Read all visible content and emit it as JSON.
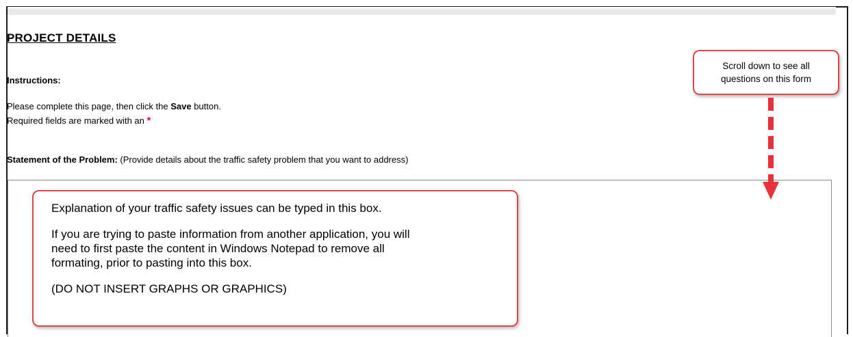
{
  "form": {
    "section_title": "PROJECT DETAILS",
    "instructions_label": "Instructions:",
    "line1_pre": "Please complete this page, then click the ",
    "line1_bold": "Save",
    "line1_post": " button.",
    "line2": "Required fields are marked with an ",
    "required_marker": "*",
    "statement_label": "Statement of the Problem:",
    "statement_hint": " (Provide details about the traffic safety problem that you want to address)"
  },
  "callouts": {
    "scroll_note": {
      "line1": "Scroll down to see all",
      "line2": "questions on this form"
    },
    "textbox_note": {
      "p1": "Explanation of your traffic safety issues can be typed in this box.",
      "p2_line1": "If you are trying to paste information from another application, you will",
      "p2_line2": "need to first paste the content in Windows Notepad to remove all",
      "p2_line3": "formating, prior to pasting into this box.",
      "p3": "(DO NOT INSERT GRAPHS OR GRAPHICS)"
    }
  },
  "colors": {
    "callout_border": "#e0444a",
    "required_marker": "#d8102a",
    "arrow": "#e8323b"
  },
  "icons": {
    "scroll_arrow": "down-arrow-icon"
  }
}
